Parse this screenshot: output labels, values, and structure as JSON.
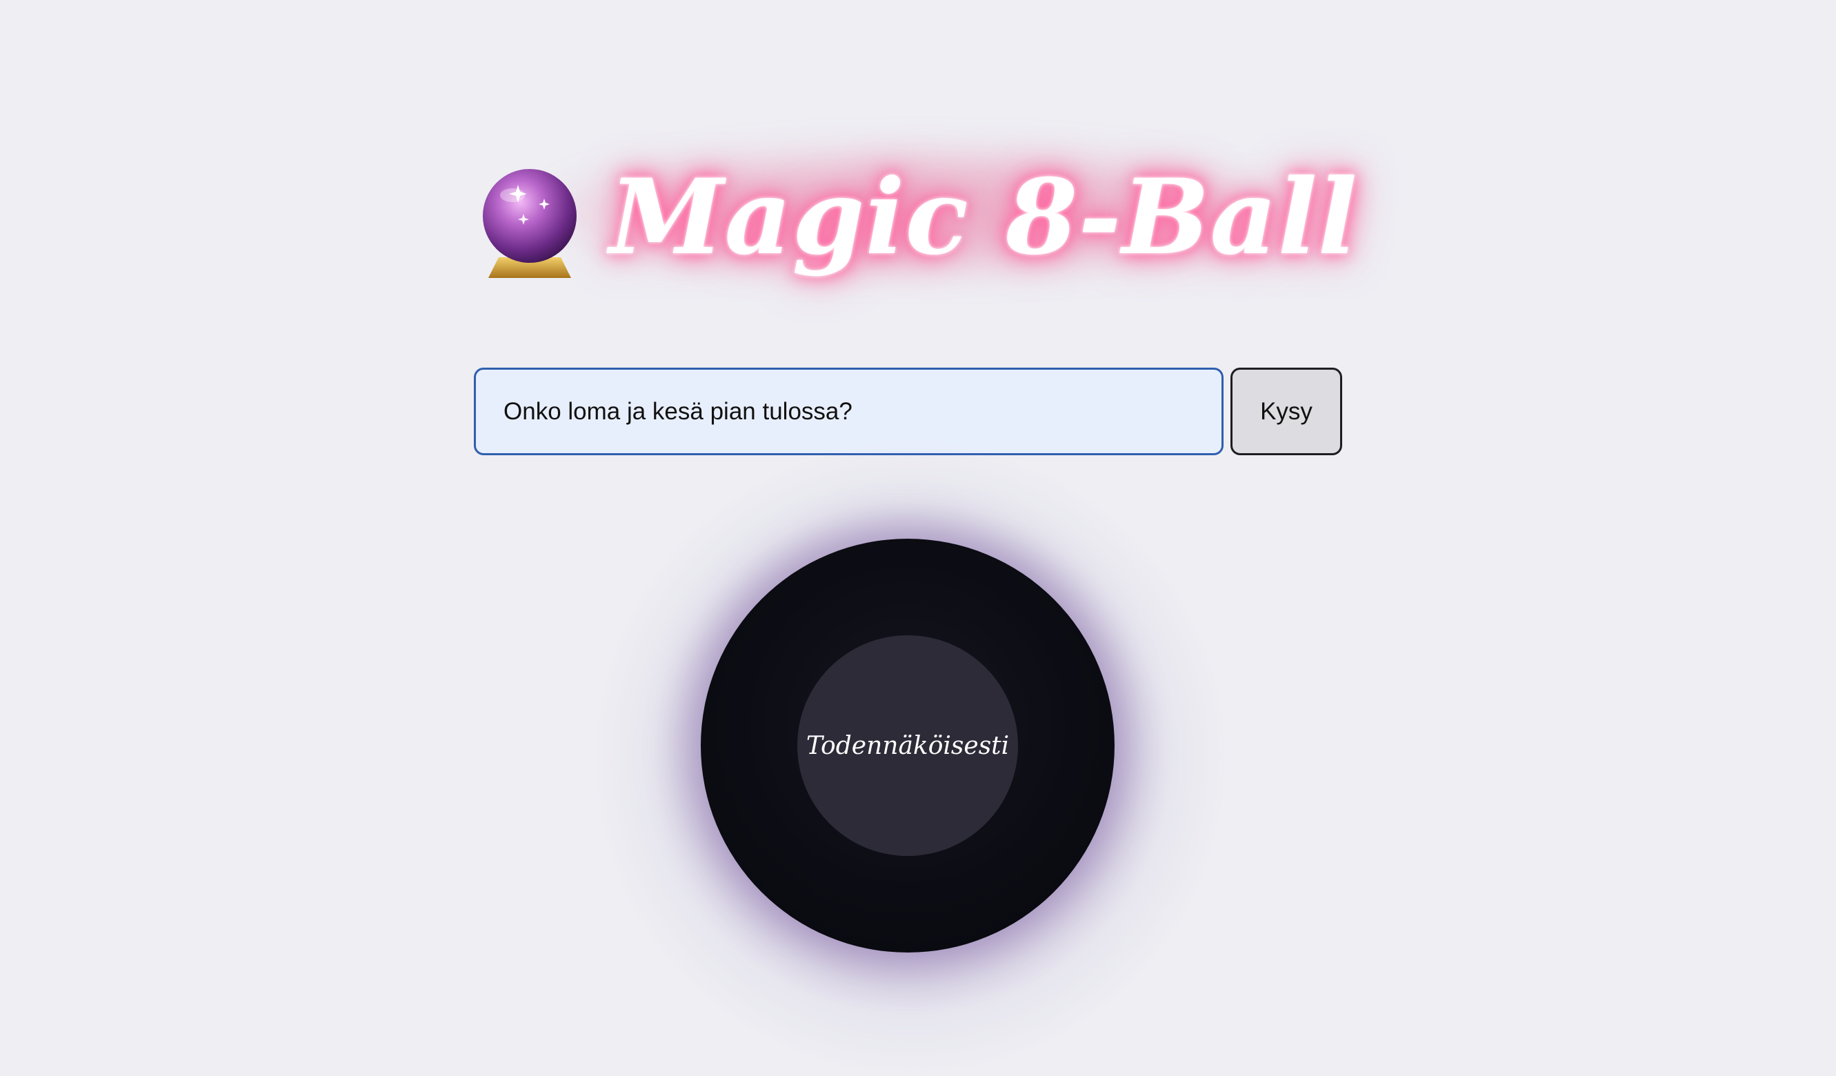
{
  "title": {
    "text": "Magic 8-Ball",
    "icon": "crystal-ball-icon"
  },
  "question": {
    "value": "Onko loma ja kesä pian tulossa?",
    "placeholder": ""
  },
  "ask_button": {
    "label": "Kysy"
  },
  "ball": {
    "answer": "Todennäköisesti"
  },
  "colors": {
    "background": "#eeeef3",
    "title_glow": "#ff6fa5",
    "input_border": "#2f5fae",
    "input_background": "#e8effc",
    "ball": "#0c0c14",
    "ball_window": "#2c2b37",
    "ball_halo": "#785aa0"
  }
}
